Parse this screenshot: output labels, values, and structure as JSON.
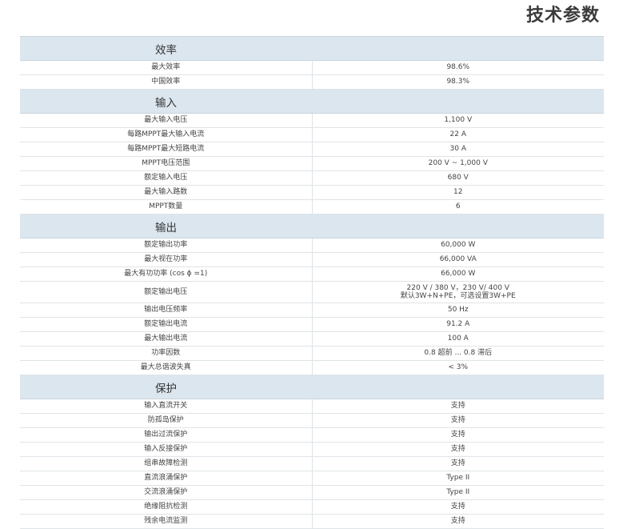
{
  "title": "技术参数",
  "sections": [
    {
      "label": "效率",
      "rows": [
        {
          "k": "最大效率",
          "v": "98.6%"
        },
        {
          "k": "中国效率",
          "v": "98.3%"
        }
      ]
    },
    {
      "label": "输入",
      "rows": [
        {
          "k": "最大输入电压",
          "v": "1,100 V"
        },
        {
          "k": "每路MPPT最大输入电流",
          "v": "22 A"
        },
        {
          "k": "每路MPPT最大短路电流",
          "v": "30 A"
        },
        {
          "k": "MPPT电压范围",
          "v": "200 V ~ 1,000 V"
        },
        {
          "k": "额定输入电压",
          "v": "680 V"
        },
        {
          "k": "最大输入路数",
          "v": "12"
        },
        {
          "k": "MPPT数量",
          "v": "6"
        }
      ]
    },
    {
      "label": "输出",
      "rows": [
        {
          "k": "额定输出功率",
          "v": "60,000 W"
        },
        {
          "k": "最大视在功率",
          "v": "66,000 VA"
        },
        {
          "k": "最大有功功率 (cos ϕ =1)",
          "v": "66,000 W"
        },
        {
          "k": "额定输出电压",
          "v": "220 V / 380 V，230 V/ 400 V",
          "v2": "默认3W+N+PE，可选设置3W+PE"
        },
        {
          "k": "输出电压频率",
          "v": "50 Hz"
        },
        {
          "k": "额定输出电流",
          "v": "91.2 A"
        },
        {
          "k": "最大输出电流",
          "v": "100 A"
        },
        {
          "k": "功率因数",
          "v": "0.8 超前 ... 0.8 滞后"
        },
        {
          "k": "最大总谐波失真",
          "v": "< 3%"
        }
      ]
    },
    {
      "label": "保护",
      "rows": [
        {
          "k": "输入直流开关",
          "v": "支持"
        },
        {
          "k": "防孤岛保护",
          "v": "支持"
        },
        {
          "k": "输出过流保护",
          "v": "支持"
        },
        {
          "k": "输入反接保护",
          "v": "支持"
        },
        {
          "k": "组串故障检测",
          "v": "支持"
        },
        {
          "k": "直流浪涌保护",
          "v": "Type II"
        },
        {
          "k": "交流浪涌保护",
          "v": "Type II"
        },
        {
          "k": "绝缘阻抗检测",
          "v": "支持"
        },
        {
          "k": "残余电流监测",
          "v": "支持"
        }
      ]
    }
  ]
}
